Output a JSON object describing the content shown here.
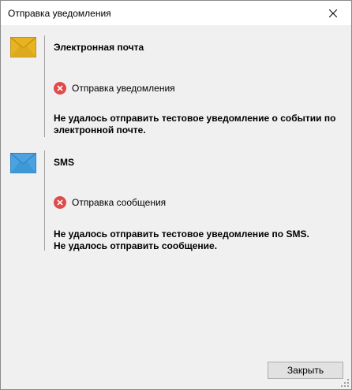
{
  "window": {
    "title": "Отправка уведомления"
  },
  "sections": [
    {
      "icon": "envelope-yellow-icon",
      "icon_color": "#e8b320",
      "title": "Электронная почта",
      "status_icon": "error-icon",
      "status_label": "Отправка уведомления",
      "message_lines": [
        "Не удалось отправить тестовое уведомление о событии по",
        "электронной почте."
      ]
    },
    {
      "icon": "envelope-blue-icon",
      "icon_color": "#4aa3df",
      "title": "SMS",
      "status_icon": "error-icon",
      "status_label": "Отправка сообщения",
      "message_lines": [
        "Не удалось отправить тестовое уведомление по SMS.",
        "Не удалось отправить сообщение."
      ]
    }
  ],
  "footer": {
    "close_label": "Закрыть"
  },
  "colors": {
    "error": "#e04a4a",
    "background": "#f0f0f0"
  }
}
